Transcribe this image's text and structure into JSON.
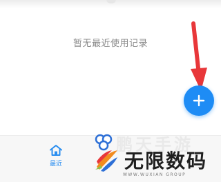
{
  "empty_state": {
    "text": "暂无最近使用记录"
  },
  "fab": {
    "icon": "plus-icon"
  },
  "bottom_nav": {
    "items": [
      {
        "label": "最近",
        "icon": "home-icon",
        "active": true
      }
    ]
  },
  "annotation": {
    "icon": "red-arrow-icon",
    "color": "#e8373a"
  },
  "watermark": {
    "top_text": "鹏天手游",
    "main_text": "无限数码",
    "sub_text": "WWW.WUXIAN GROUP"
  },
  "colors": {
    "accent": "#1e8cf5",
    "arrow": "#e8373a",
    "empty_text": "#8a8a8a",
    "nav_bg": "#f7f7f7"
  }
}
